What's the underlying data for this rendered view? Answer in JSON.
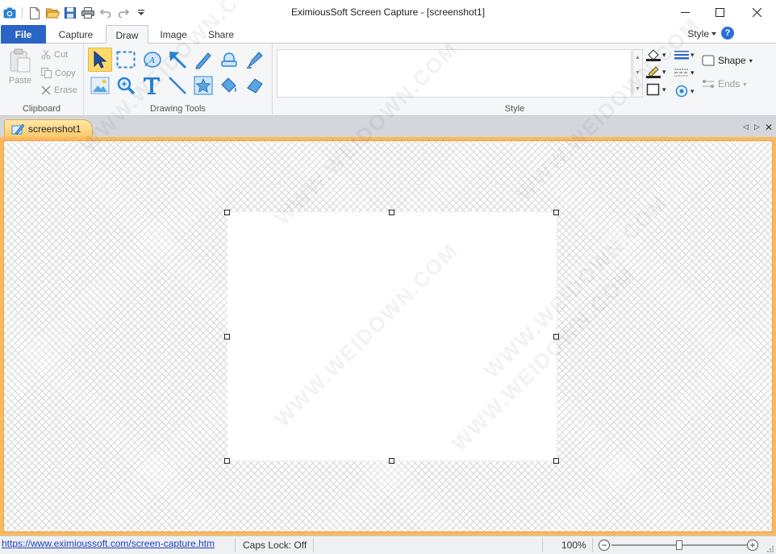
{
  "window": {
    "title": "EximiousSoft Screen Capture - [screenshot1]"
  },
  "quick_access": {
    "icons": [
      "app-camera-icon",
      "new-icon",
      "open-icon",
      "save-icon",
      "print-icon",
      "undo-icon",
      "redo-icon",
      "customize-icon"
    ]
  },
  "tabs": {
    "file": "File",
    "items": [
      {
        "label": "Capture"
      },
      {
        "label": "Draw"
      },
      {
        "label": "Image"
      },
      {
        "label": "Share"
      }
    ],
    "active": "Draw",
    "style_menu": "Style"
  },
  "ribbon": {
    "clipboard": {
      "label": "Clipboard",
      "paste": "Paste",
      "cut": "Cut",
      "copy": "Copy",
      "erase": "Erase"
    },
    "drawing_tools": {
      "label": "Drawing Tools"
    },
    "style": {
      "label": "Style"
    },
    "shape": {
      "shape_label": "Shape",
      "ends_label": "Ends"
    }
  },
  "document": {
    "tab_label": "screenshot1"
  },
  "statusbar": {
    "link": "https://www.eximioussoft.com/screen-capture.htm",
    "caps_lock": "Caps Lock: Off",
    "zoom": "100%"
  },
  "watermark": "WWW.WEIDOWN.COM",
  "colors": {
    "accent": "#2a64c4",
    "selection": "#fcd96b",
    "canvas_border": "#fbb95b"
  }
}
